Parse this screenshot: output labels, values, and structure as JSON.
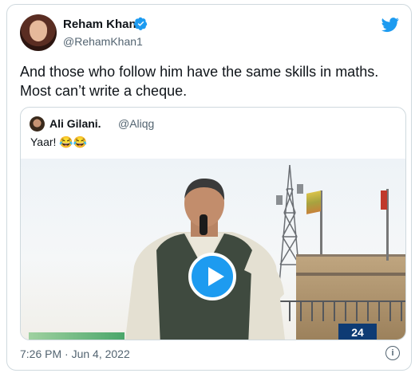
{
  "tweet": {
    "author_name": "Reham Khan",
    "author_handle": "@RehamKhan1",
    "text": "And those who follow him have the same skills in maths. Most can’t write a cheque.",
    "timestamp": "7:26 PM · Jun 4, 2022"
  },
  "quoted_tweet": {
    "author_name": "Ali Gilani.",
    "author_handle": "@Aliqg",
    "text": "Yaar! 😂😂"
  },
  "media": {
    "channel_logo": "24"
  },
  "icons": {
    "verified": "verified-badge-icon",
    "twitter": "twitter-bird-icon",
    "play": "play-icon",
    "info": "info-icon"
  },
  "colors": {
    "accent": "#1d9bf0",
    "text": "#0f1419",
    "secondary": "#536471",
    "border": "#cfd9de"
  }
}
